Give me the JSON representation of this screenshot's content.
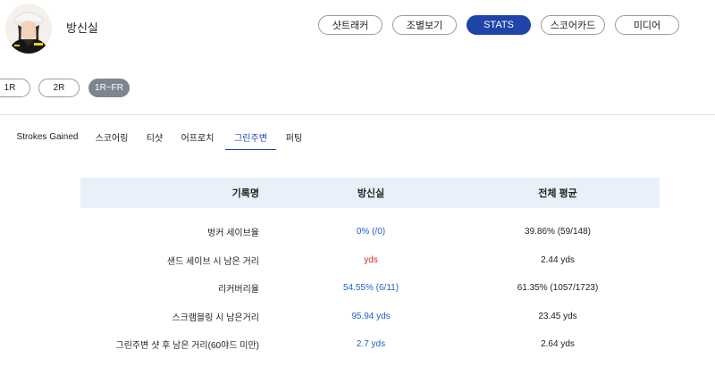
{
  "player": {
    "name": "방신실"
  },
  "nav": {
    "items": [
      {
        "label": "샷트래커",
        "active": false
      },
      {
        "label": "조별보기",
        "active": false
      },
      {
        "label": "STATS",
        "active": true
      },
      {
        "label": "스코어카드",
        "active": false
      },
      {
        "label": "미디어",
        "active": false
      }
    ]
  },
  "rounds": {
    "items": [
      {
        "label": "1R",
        "active": false
      },
      {
        "label": "2R",
        "active": false
      },
      {
        "label": "1R~FR",
        "active": true
      }
    ]
  },
  "tabs": {
    "items": [
      {
        "label": "Strokes Gained",
        "active": false
      },
      {
        "label": "스코어링",
        "active": false
      },
      {
        "label": "티샷",
        "active": false
      },
      {
        "label": "어프로치",
        "active": false
      },
      {
        "label": "그린주변",
        "active": true
      },
      {
        "label": "퍼팅",
        "active": false
      }
    ]
  },
  "table": {
    "headers": [
      "기록명",
      "방신실",
      "전체 평균"
    ],
    "rows": [
      {
        "name": "벙커 세이브율",
        "player": "0% (/0)",
        "avg": "39.86% (59/148)",
        "player_color": "blue"
      },
      {
        "name": "샌드 세이브 시 남은 거리",
        "player": "yds",
        "avg": "2.44 yds",
        "player_color": "red"
      },
      {
        "name": "리커버리율",
        "player": "54.55% (6/11)",
        "avg": "61.35% (1057/1723)",
        "player_color": "blue"
      },
      {
        "name": "스크램블링 시 남은거리",
        "player": "95.94 yds",
        "avg": "23.45 yds",
        "player_color": "blue"
      },
      {
        "name": "그린주변 샷 후 남은 거리(60야드 미만)",
        "player": "2.7 yds",
        "avg": "2.64 yds",
        "player_color": "blue"
      }
    ]
  },
  "colors": {
    "accent": "#1f45a8",
    "link_blue": "#2060c8",
    "alert_red": "#d02828",
    "header_bg": "#e9f0f9",
    "round_active": "#7d8690"
  }
}
